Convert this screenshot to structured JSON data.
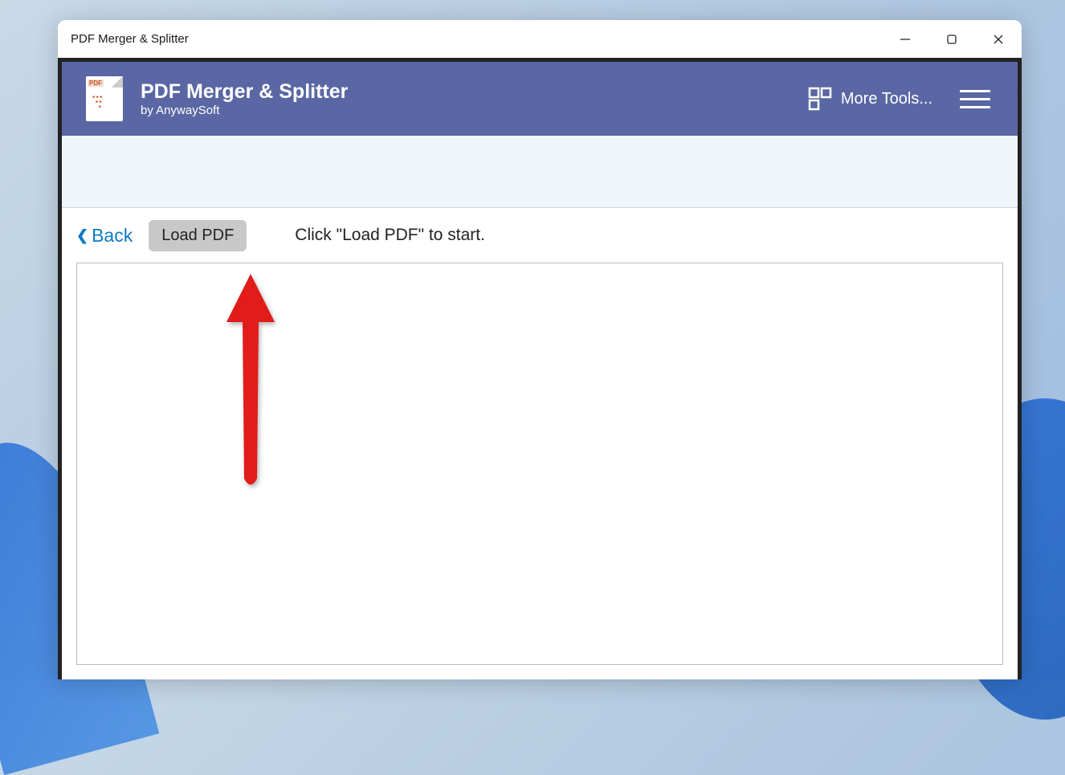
{
  "window": {
    "title": "PDF Merger & Splitter"
  },
  "header": {
    "app_title": "PDF Merger & Splitter",
    "app_subtitle": "by AnywaySoft",
    "logo_badge": "PDF",
    "more_tools_label": "More Tools..."
  },
  "toolbar": {
    "back_label": "Back",
    "load_pdf_label": "Load PDF",
    "hint_text": "Click \"Load PDF\" to start."
  },
  "colors": {
    "header_bg": "#5a67a4",
    "accent_link": "#0e7ac4",
    "annotation_red": "#e21b1b"
  }
}
